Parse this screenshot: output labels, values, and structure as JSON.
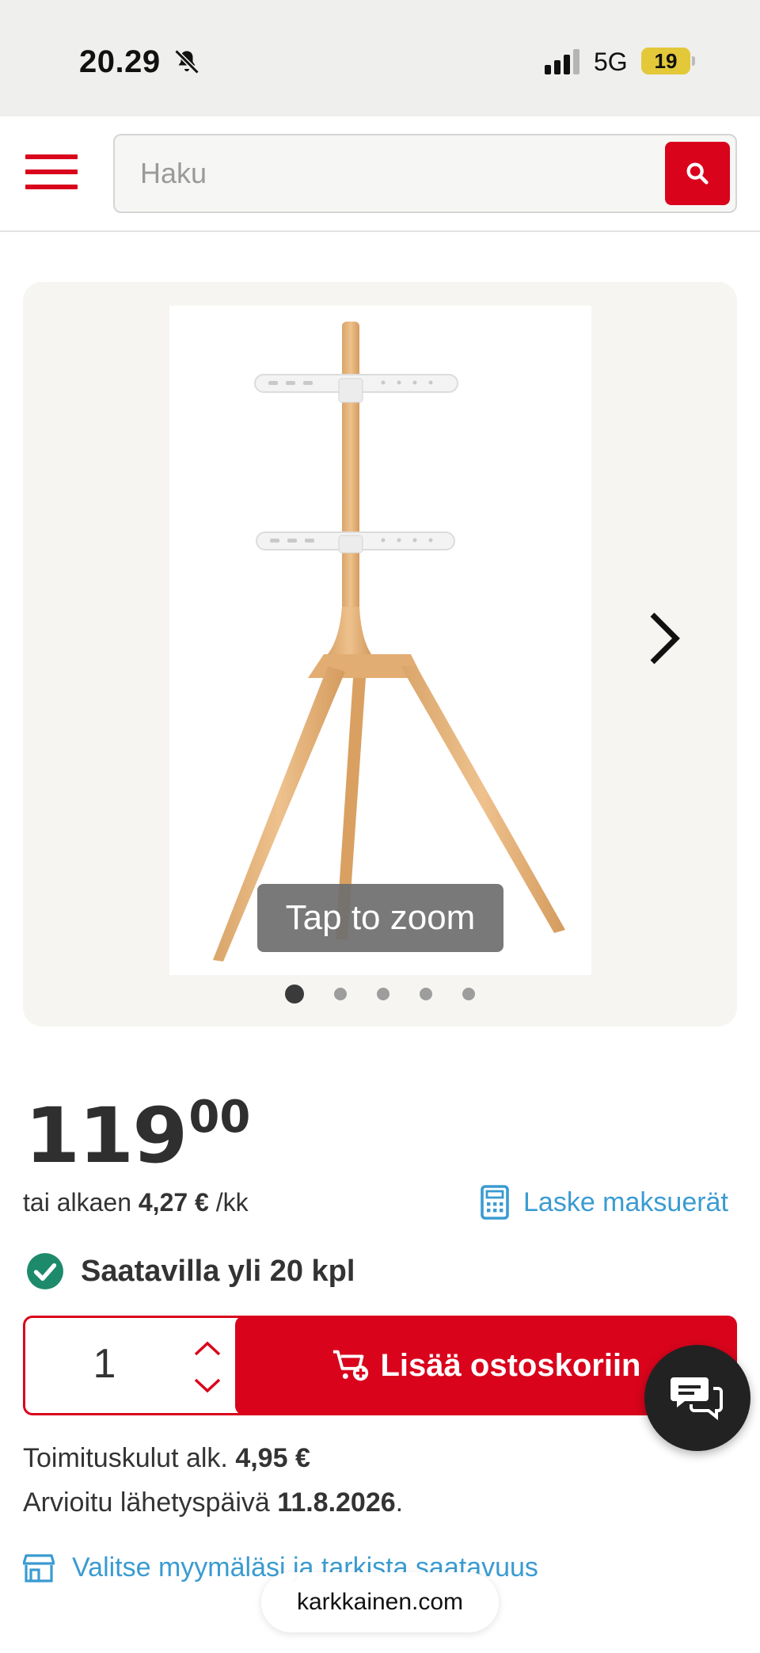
{
  "status_bar": {
    "time": "20.29",
    "network": "5G",
    "battery": "19"
  },
  "header": {
    "search_placeholder": "Haku"
  },
  "gallery": {
    "zoom_label": "Tap to zoom",
    "slide_count": 5,
    "active_slide": 1
  },
  "product": {
    "price_main": "119",
    "price_cents": "00",
    "installment_prefix": "tai alkaen",
    "installment_amount": "4,27 €",
    "installment_suffix": "/kk",
    "calc_link": "Laske maksuerät",
    "availability": "Saatavilla yli 20 kpl"
  },
  "cart": {
    "quantity": "1",
    "add_label": "Lisää ostoskoriin"
  },
  "delivery": {
    "shipping_label": "Toimituskulut alk.",
    "shipping_amount": "4,95 €",
    "dispatch_label": "Arvioitu lähetyspäivä",
    "dispatch_date": "11.8.2026",
    "dispatch_end": "."
  },
  "store": {
    "link": "Valitse myymäläsi ja tarkista saatavuus"
  },
  "browser": {
    "url": "karkkainen.com"
  },
  "colors": {
    "brand_red": "#d9041c",
    "link_blue": "#3a9bd1",
    "success_green": "#1e8a6c"
  }
}
